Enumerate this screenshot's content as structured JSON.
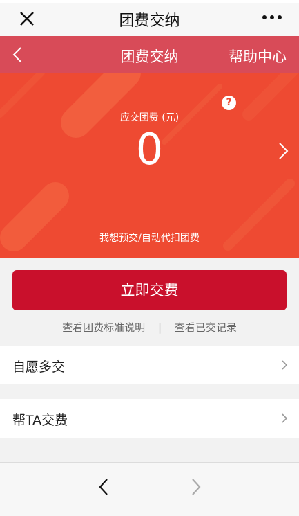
{
  "app_bar": {
    "title": "团费交纳"
  },
  "header": {
    "title": "团费交纳",
    "help_label": "帮助中心"
  },
  "hero": {
    "amount_label": "应交团费 (元)",
    "amount_value": "0",
    "help_glyph": "?",
    "prepay_link": "我想预交/自动代扣团费",
    "background_color": "#ee4a32"
  },
  "actions": {
    "pay_button": "立即交费",
    "standard_link": "查看团费标准说明",
    "separator": "|",
    "records_link": "查看已交记录",
    "button_color": "#c9102c"
  },
  "list": [
    {
      "label": "自愿多交"
    },
    {
      "label": "帮TA交费"
    }
  ],
  "icons": {
    "close": "close-icon",
    "more": "more-dots-icon",
    "back": "chevron-left-icon",
    "forward": "chevron-right-icon"
  }
}
